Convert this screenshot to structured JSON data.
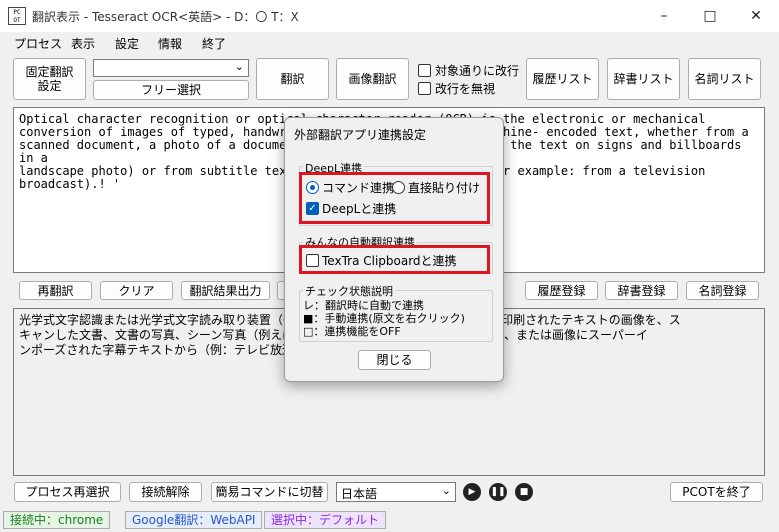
{
  "window": {
    "title": "翻訳表示 - Tesseract OCR<英語> - D：〇 T：X",
    "icon_text": "PC\nOT"
  },
  "menu": [
    "プロセス",
    "表示",
    "設定",
    "情報",
    "終了"
  ],
  "toolbar": {
    "fixed_translate": "固定翻訳\n設定",
    "combo_value": "",
    "free_select": "フリー選択",
    "translate": "翻訳",
    "image_translate": "画像翻訳",
    "linebreak_label": "対象通りに改行",
    "ignore_linebreak_label": "改行を無視",
    "history_list": "履歴リスト",
    "dictionary_list": "辞書リスト",
    "noun_list": "名詞リスト"
  },
  "source_text": "Optical character recognition or optical character reader (OCR) is the electronic or mechanical\nconversion of images of typed, handwritten or printed text into machine- encoded text, whether from a\nscanned document, a photo of a document, a scene-photo (for example the text on signs and billboards in a\nlandscape photo) or from subtitle text superimposed on an image (for example: from a television\nbroadcast).! '",
  "mid_buttons": {
    "retranslate": "再翻訳",
    "clear": "クリア",
    "output_result": "翻訳結果出力",
    "history_register": "履歴登録",
    "dictionary_register": "辞書登録",
    "noun_register": "名詞登録"
  },
  "result_text": "光学式文字認識または光学式文字読み取り装置（OCR）は、タイプされた、手書きまたは印刷されたテキストの画像を、ス\nキャンした文書、文書の写真、シーン写真（例えば、看板や広告板の風景写真のテキスト）、または画像にスーパーイ\nンポーズされた字幕テキストから（例：テレビ放送から）",
  "bottom": {
    "reselect_process": "プロセス再選択",
    "disconnect": "接続解除",
    "switch_simple": "簡易コマンドに切替",
    "language": "日本語",
    "exit": "PCOTを終了"
  },
  "status": {
    "connected": "接続中：chrome",
    "google": "Google翻訳：WebAPI",
    "selected": "選択中：デフォルト"
  },
  "dialog": {
    "title": "外部翻訳アプリ連携設定",
    "deepl_group": "DeepL連携",
    "radio_command": "コマンド連携",
    "radio_paste": "直接貼り付け",
    "chk_deepl": "DeepLと連携",
    "minna_group": "みんなの自動翻訳連携",
    "chk_textra": "TexTra Clipboardと連携",
    "check_group": "チェック状態説明",
    "explain_1": "レ：翻訳時に自動で連携",
    "explain_2": "■：手動連携(原文を右クリック)",
    "explain_3": "□：連携機能をOFF",
    "close": "閉じる"
  },
  "colors": {
    "accent": "#005fb8",
    "highlight_red": "#e0141e",
    "status_green": "#1a7f1a",
    "status_blue": "#2a55c8",
    "status_purple": "#8a2be2"
  }
}
